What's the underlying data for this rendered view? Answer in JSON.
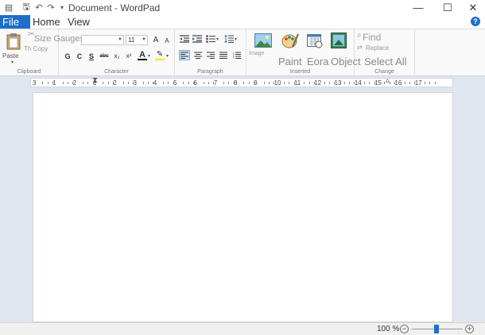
{
  "titlebar": {
    "title": "Document - WordPad",
    "quick_access": {
      "app_icon": "wordpad-icon",
      "save_icon": "save-icon",
      "undo_icon": "undo-icon",
      "redo_icon": "redo-icon",
      "customize_icon": "customize-quick-access-icon"
    },
    "minimize": "—",
    "maximize": "☐",
    "close": "✕"
  },
  "tabs": {
    "file": "File",
    "home": "Home",
    "view": "View",
    "help": "?"
  },
  "ribbon": {
    "clipboard": {
      "label": "Clipboard",
      "paste": "Paste",
      "cut_label": "Size Gauges",
      "copy_label": "Th Copy"
    },
    "font": {
      "label": "Character",
      "font_name": "",
      "font_size": "11",
      "grow": "A",
      "shrink": "A",
      "bold": "G",
      "italic": "C",
      "underline": "S",
      "strikethrough": "abc",
      "subscript": "x₂",
      "superscript": "x²",
      "font_color": "A",
      "highlight": "✎"
    },
    "paragraph": {
      "label": "Paragraph"
    },
    "insert": {
      "label": "Inserted",
      "image_label": "Image",
      "paint_label": "Paint",
      "datetime_label": "Eora",
      "object_label": "Object"
    },
    "editing": {
      "label": "Change",
      "find": "Find",
      "replace": "Replace",
      "select_all": "Select All"
    }
  },
  "ruler": {
    "numbers": [
      "3",
      "1",
      "2",
      "1",
      "2",
      "3",
      "4",
      "5",
      "6",
      "7",
      "8",
      "9",
      "10",
      "11",
      "12",
      "13",
      "14",
      "15",
      "16",
      "17"
    ]
  },
  "statusbar": {
    "zoom": "100 %",
    "zoom_out": "−",
    "zoom_in": "+",
    "zoom_level": 100
  },
  "colors": {
    "accent": "#1e6fc8",
    "workspace": "#dfe6f0"
  }
}
